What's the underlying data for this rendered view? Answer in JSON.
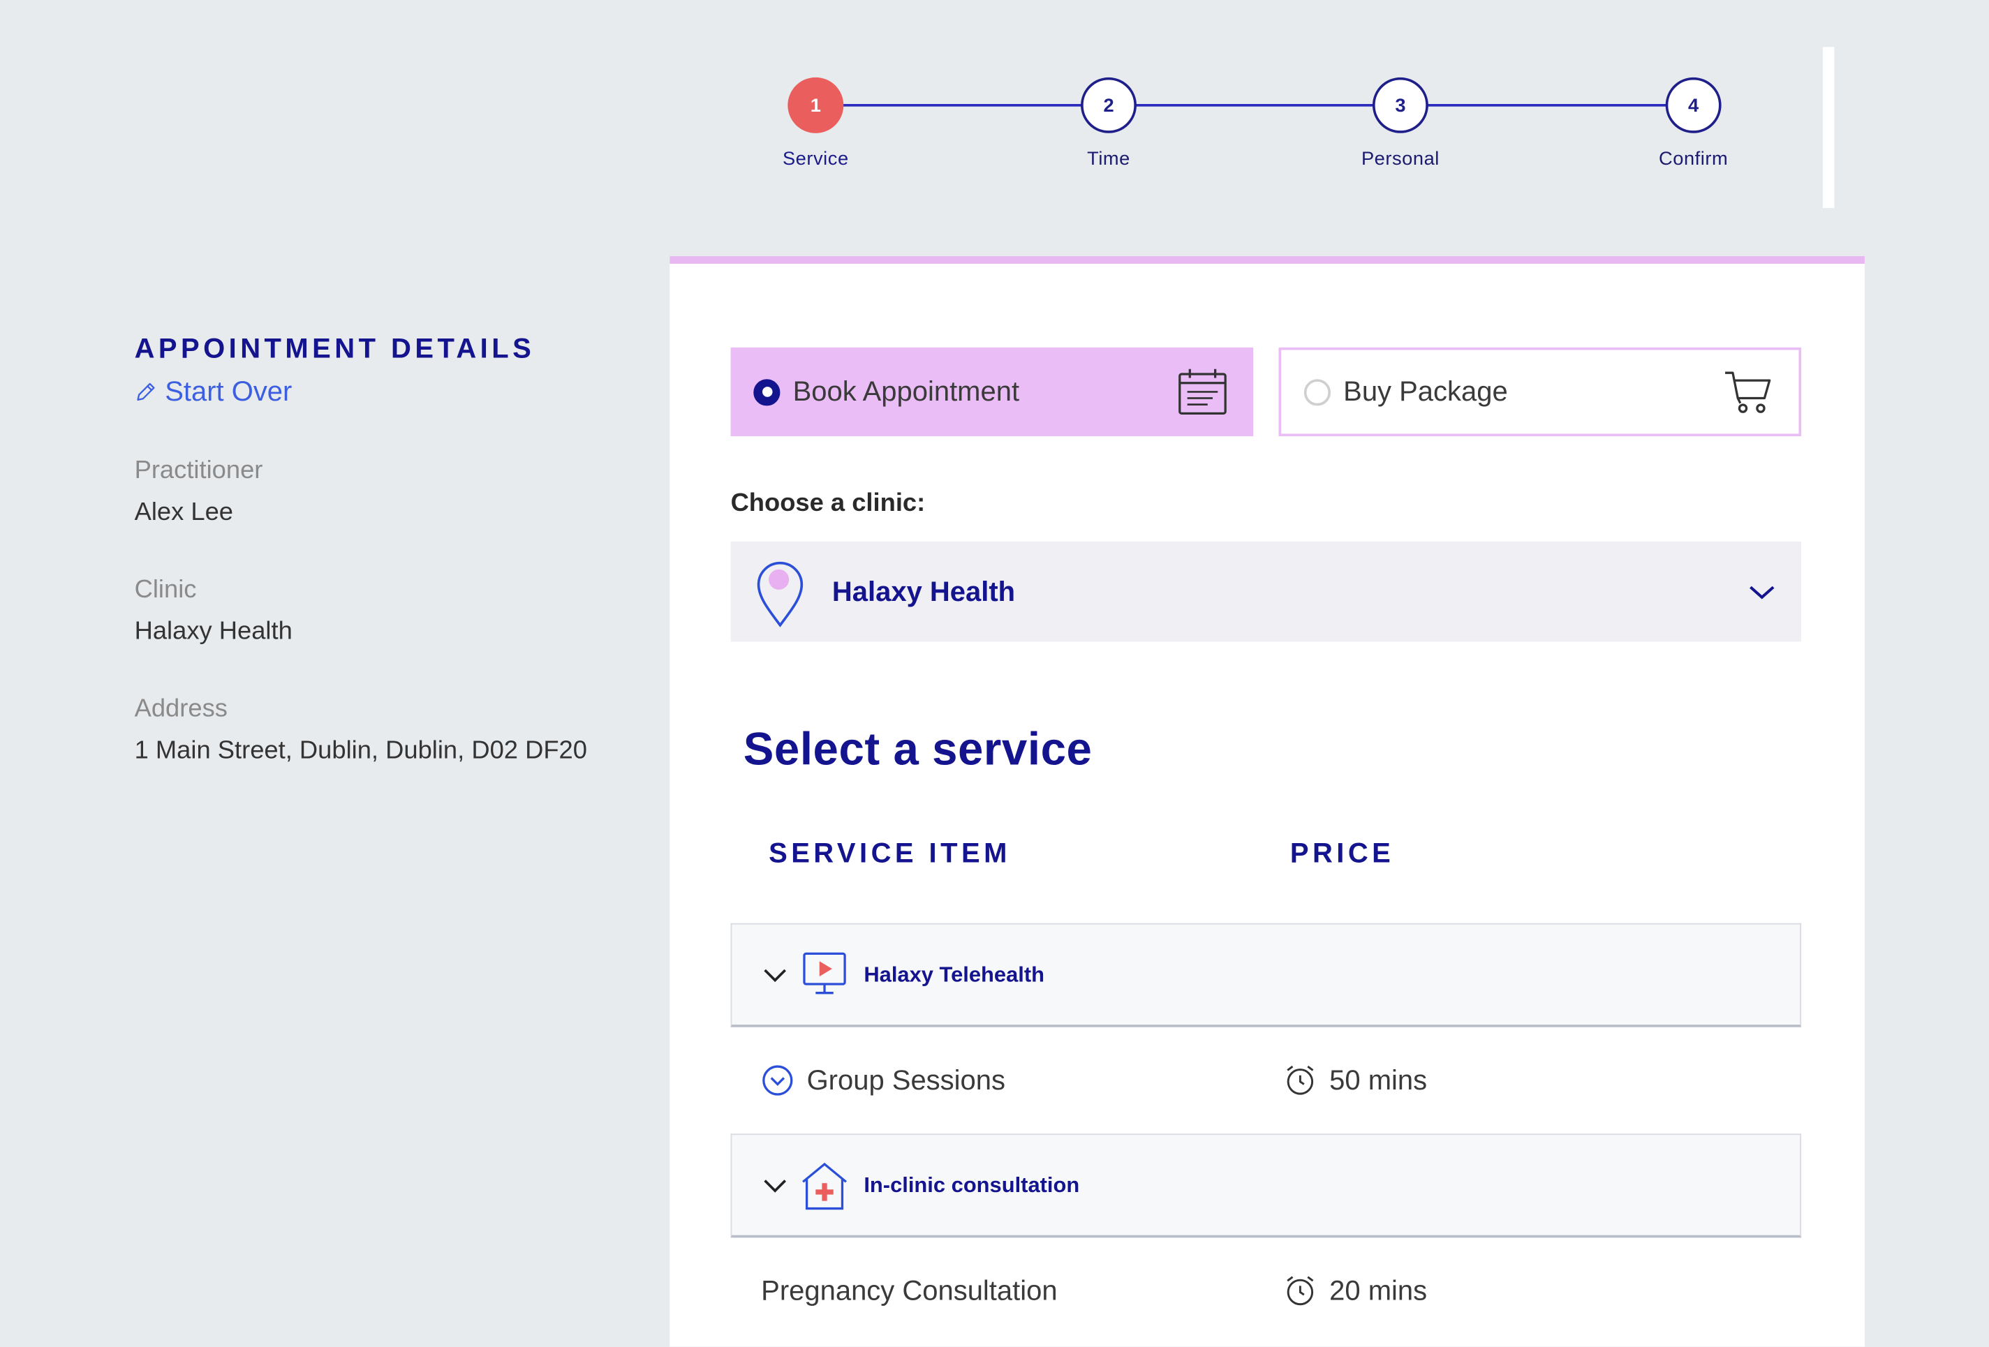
{
  "stepper": {
    "steps": [
      {
        "number": "1",
        "label": "Service",
        "active": true
      },
      {
        "number": "2",
        "label": "Time",
        "active": false
      },
      {
        "number": "3",
        "label": "Personal",
        "active": false
      },
      {
        "number": "4",
        "label": "Confirm",
        "active": false
      }
    ]
  },
  "details": {
    "heading": "APPOINTMENT DETAILS",
    "start_over": "Start Over",
    "practitioner_label": "Practitioner",
    "practitioner_value": "Alex Lee",
    "clinic_label": "Clinic",
    "clinic_value": "Halaxy Health",
    "address_label": "Address",
    "address_value": "1 Main Street, Dublin, Dublin, D02 DF20"
  },
  "booking_type": {
    "book_label": "Book Appointment",
    "book_icon": "calendar-icon",
    "package_label": "Buy Package",
    "package_icon": "cart-icon",
    "selected": "book"
  },
  "clinic": {
    "prompt": "Choose a clinic:",
    "selected": "Halaxy Health",
    "icon": "map-pin-icon"
  },
  "services": {
    "title": "Select a service",
    "col_item": "SERVICE ITEM",
    "col_price": "PRICE",
    "groups": [
      {
        "name": "Halaxy Telehealth",
        "icon": "telehealth-screen-icon",
        "items": [
          {
            "name": "Group Sessions",
            "duration": "50 mins"
          }
        ]
      },
      {
        "name": "In-clinic consultation",
        "icon": "clinic-building-icon",
        "items": [
          {
            "name": "Pregnancy Consultation",
            "duration": "20 mins"
          }
        ]
      }
    ]
  },
  "colors": {
    "primary": "#14148f",
    "accent_red": "#ea5e5e",
    "accent_pink": "#ebbdf7",
    "link_blue": "#3b5fe0",
    "background": "#e8ebee"
  }
}
